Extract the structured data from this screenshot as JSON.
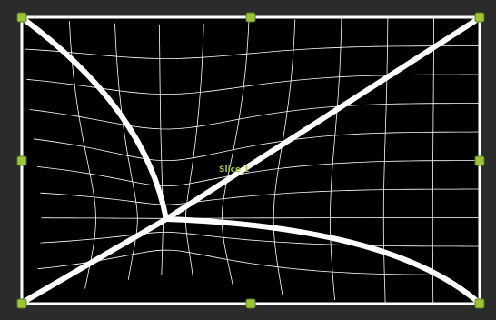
{
  "slice": {
    "label": "Slice 1",
    "label_color": "#9bc43a"
  },
  "colors": {
    "workspace": "#2b2b2b",
    "canvas": "#000000",
    "mesh": "#ffffff",
    "handle_fill": "#9bc43a",
    "handle_stroke": "#5a7a1a"
  },
  "icons": [
    "transform-handle"
  ]
}
